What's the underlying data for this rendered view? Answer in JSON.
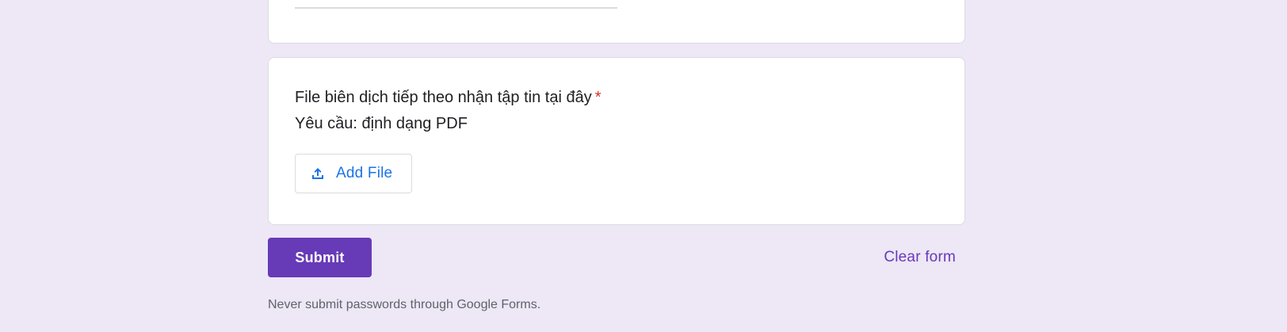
{
  "upload_question": {
    "title": "File biên dịch tiếp theo nhận tập tin tại đây",
    "required_marker": "*",
    "description": "Yêu cầu: định dạng PDF",
    "add_file_label": "Add File",
    "add_file_icon": "upload-icon"
  },
  "actions": {
    "submit_label": "Submit",
    "clear_label": "Clear form"
  },
  "footer": {
    "note": "Never submit passwords through Google Forms."
  },
  "colors": {
    "page_background": "#ede7f6",
    "accent": "#673ab7",
    "link_blue": "#1a73e8",
    "required_red": "#d93025"
  }
}
